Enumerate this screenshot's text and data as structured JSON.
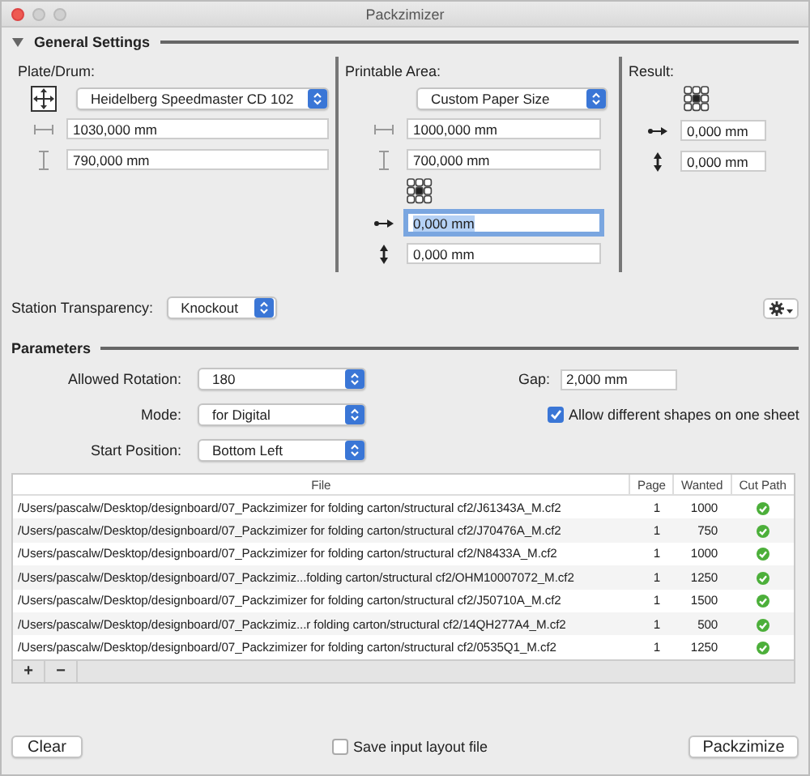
{
  "window": {
    "title": "Packzimizer"
  },
  "general_settings": {
    "title": "General Settings",
    "expanded": true,
    "plate": {
      "label": "Plate/Drum:",
      "select": "Heidelberg Speedmaster CD 102",
      "width": "1030,000 mm",
      "height": "790,000 mm"
    },
    "printable_area": {
      "label": "Printable Area:",
      "select": "Custom Paper Size",
      "width": "1000,000 mm",
      "height": "700,000 mm",
      "offset_x": {
        "value": "0,000 mm",
        "focused": true
      },
      "offset_y": {
        "value": "0,000 mm",
        "focused": false
      }
    },
    "result": {
      "label": "Result:",
      "offset_x": "0,000 mm",
      "offset_y": "0,000 mm"
    },
    "station_transparency": {
      "label": "Station Transparency:",
      "value": "Knockout"
    }
  },
  "parameters": {
    "title": "Parameters",
    "selects": [
      {
        "label": "Allowed Rotation:",
        "value": "180"
      },
      {
        "label": "Mode:",
        "value": "for Digital"
      },
      {
        "label": "Start Position:",
        "value": "Bottom Left"
      }
    ],
    "gap": {
      "label": "Gap:",
      "value": "2,000 mm"
    },
    "allow_different_shapes": {
      "label": "Allow different shapes on one sheet",
      "checked": true
    }
  },
  "table": {
    "columns": [
      "File",
      "Page",
      "Wanted",
      "Cut Path"
    ],
    "rows": [
      {
        "file": "/Users/pascalw/Desktop/designboard/07_Packzimizer for folding carton/structural cf2/J61343A_M.cf2",
        "page": "1",
        "wanted": "1000",
        "cut_path": true
      },
      {
        "file": "/Users/pascalw/Desktop/designboard/07_Packzimizer for folding carton/structural cf2/J70476A_M.cf2",
        "page": "1",
        "wanted": "750",
        "cut_path": true
      },
      {
        "file": "/Users/pascalw/Desktop/designboard/07_Packzimizer for folding carton/structural cf2/N8433A_M.cf2",
        "page": "1",
        "wanted": "1000",
        "cut_path": true
      },
      {
        "file": "/Users/pascalw/Desktop/designboard/07_Packzimiz...folding carton/structural cf2/OHM10007072_M.cf2",
        "page": "1",
        "wanted": "1250",
        "cut_path": true
      },
      {
        "file": "/Users/pascalw/Desktop/designboard/07_Packzimizer for folding carton/structural cf2/J50710A_M.cf2",
        "page": "1",
        "wanted": "1500",
        "cut_path": true
      },
      {
        "file": "/Users/pascalw/Desktop/designboard/07_Packzimiz...r folding carton/structural cf2/14QH277A4_M.cf2",
        "page": "1",
        "wanted": "500",
        "cut_path": true
      },
      {
        "file": "/Users/pascalw/Desktop/designboard/07_Packzimizer for folding carton/structural cf2/0535Q1_M.cf2",
        "page": "1",
        "wanted": "1250",
        "cut_path": true
      }
    ],
    "add": "+",
    "remove": "−"
  },
  "footer": {
    "clear": "Clear",
    "save_layout": {
      "label": "Save input layout file",
      "checked": false
    },
    "run": "Packzimize"
  }
}
